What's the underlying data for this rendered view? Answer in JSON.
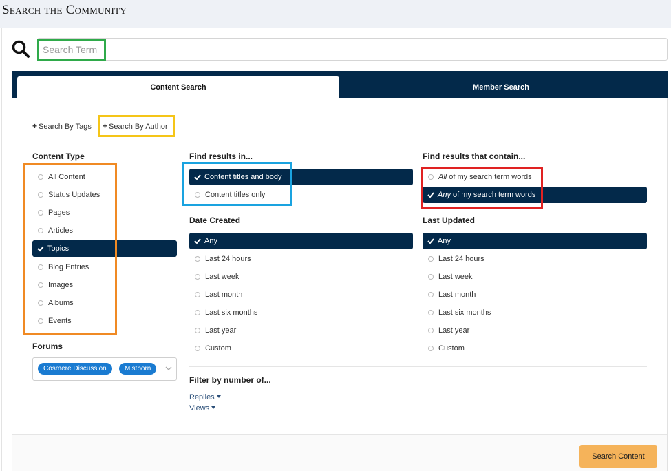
{
  "page": {
    "title": "Search the Community"
  },
  "search": {
    "placeholder": "Search Term",
    "value": ""
  },
  "tabs": [
    {
      "label": "Content Search",
      "active": true
    },
    {
      "label": "Member Search",
      "active": false
    }
  ],
  "links": {
    "search_by_tags": "Search By Tags",
    "search_by_author": "Search By Author"
  },
  "content_type": {
    "title": "Content Type",
    "options": [
      {
        "label": "All Content",
        "selected": false
      },
      {
        "label": "Status Updates",
        "selected": false
      },
      {
        "label": "Pages",
        "selected": false
      },
      {
        "label": "Articles",
        "selected": false
      },
      {
        "label": "Topics",
        "selected": true
      },
      {
        "label": "Blog Entries",
        "selected": false
      },
      {
        "label": "Images",
        "selected": false
      },
      {
        "label": "Albums",
        "selected": false
      },
      {
        "label": "Events",
        "selected": false
      }
    ]
  },
  "forums": {
    "title": "Forums",
    "chips": [
      "Cosmere Discussion",
      "Mistborn"
    ]
  },
  "find_results_in": {
    "title": "Find results in...",
    "options": [
      {
        "label": "Content titles and body",
        "selected": true
      },
      {
        "label": "Content titles only",
        "selected": false
      }
    ]
  },
  "find_results_contain": {
    "title": "Find results that contain...",
    "options": [
      {
        "em": "All",
        "label": "of my search term words",
        "selected": false
      },
      {
        "em": "Any",
        "label": "of my search term words",
        "selected": true
      }
    ]
  },
  "date_created": {
    "title": "Date Created",
    "options": [
      {
        "label": "Any",
        "selected": true
      },
      {
        "label": "Last 24 hours",
        "selected": false
      },
      {
        "label": "Last week",
        "selected": false
      },
      {
        "label": "Last month",
        "selected": false
      },
      {
        "label": "Last six months",
        "selected": false
      },
      {
        "label": "Last year",
        "selected": false
      },
      {
        "label": "Custom",
        "selected": false
      }
    ]
  },
  "last_updated": {
    "title": "Last Updated",
    "options": [
      {
        "label": "Any",
        "selected": true
      },
      {
        "label": "Last 24 hours",
        "selected": false
      },
      {
        "label": "Last week",
        "selected": false
      },
      {
        "label": "Last month",
        "selected": false
      },
      {
        "label": "Last six months",
        "selected": false
      },
      {
        "label": "Last year",
        "selected": false
      },
      {
        "label": "Custom",
        "selected": false
      }
    ]
  },
  "filter": {
    "title": "Filter by number of...",
    "replies": "Replies",
    "views": "Views"
  },
  "footer": {
    "submit_label": "Search Content"
  },
  "colors": {
    "navy": "#03294a",
    "submit": "#f5b35a",
    "chip": "#1a7bd1",
    "highlight_green": "#2faa4a",
    "highlight_yellow": "#f5c518",
    "highlight_orange": "#f08a24",
    "highlight_blue": "#1aa3e0",
    "highlight_red": "#e02222"
  }
}
